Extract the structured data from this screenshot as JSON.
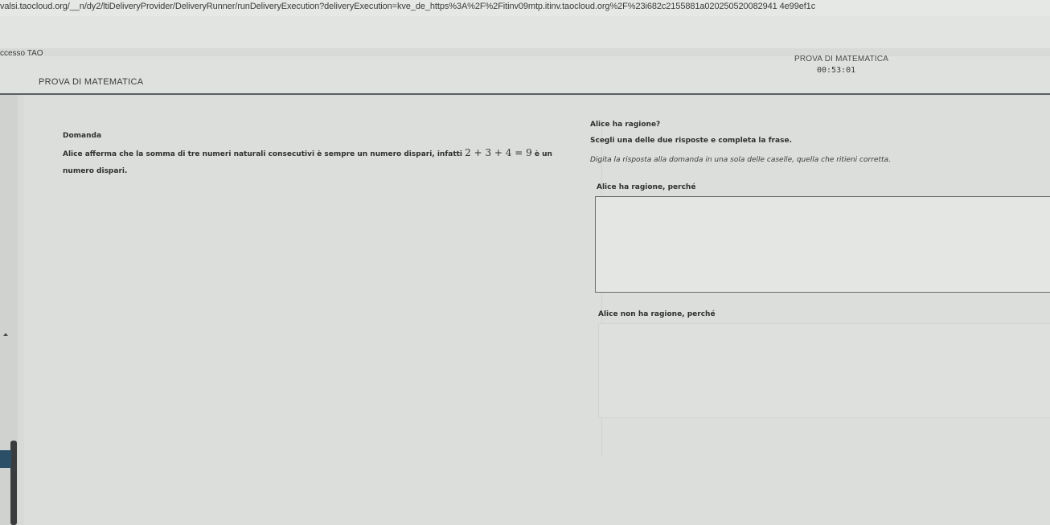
{
  "browser": {
    "url": "valsi.taocloud.org/__n/dy2/ltiDeliveryProvider/DeliveryRunner/runDeliveryExecution?deliveryExecution=kve_de_https%3A%2F%2Fitinv09mtp.itinv.taocloud.org%2F%23i682c2155881a020250520082941 4e99ef1c",
    "tab_title": "ccesso TAO"
  },
  "header": {
    "test_title": "PROVA DI MATEMATICA",
    "test_title_right": "PROVA DI MATEMATICA",
    "timer": "00:53:01"
  },
  "question": {
    "label": "Domanda",
    "text_part1": "Alice afferma che la somma di tre numeri naturali consecutivi è sempre un numero dispari, infatti",
    "formula": "2 + 3 + 4 = 9",
    "text_part2": "è un",
    "text_part3": "numero dispari."
  },
  "answer": {
    "question": "Alice ha ragione?",
    "instruction": "Scegli una delle due risposte e completa la frase.",
    "hint": "Digita la risposta alla domanda in una sola delle caselle, quella che ritieni corretta.",
    "option1_label": "Alice ha ragione, perché",
    "option1_value": "",
    "option2_label": "Alice non ha ragione, perché",
    "option2_value": ""
  }
}
